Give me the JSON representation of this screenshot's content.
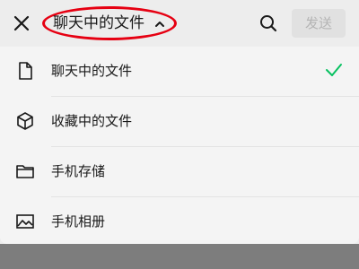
{
  "header": {
    "title": "聊天中的文件",
    "send_label": "发送",
    "icons": {
      "close": "close-icon",
      "caret": "chevron-up-icon",
      "search": "search-icon"
    }
  },
  "menu": {
    "items": [
      {
        "label": "聊天中的文件",
        "icon": "document-icon",
        "selected": true
      },
      {
        "label": "收藏中的文件",
        "icon": "cube-icon",
        "selected": false
      },
      {
        "label": "手机存储",
        "icon": "folder-icon",
        "selected": false
      },
      {
        "label": "手机相册",
        "icon": "image-icon",
        "selected": false
      }
    ]
  },
  "colors": {
    "accent": "#07c160",
    "highlight_ring": "#e60012",
    "send_bg": "#e1e1e1"
  }
}
